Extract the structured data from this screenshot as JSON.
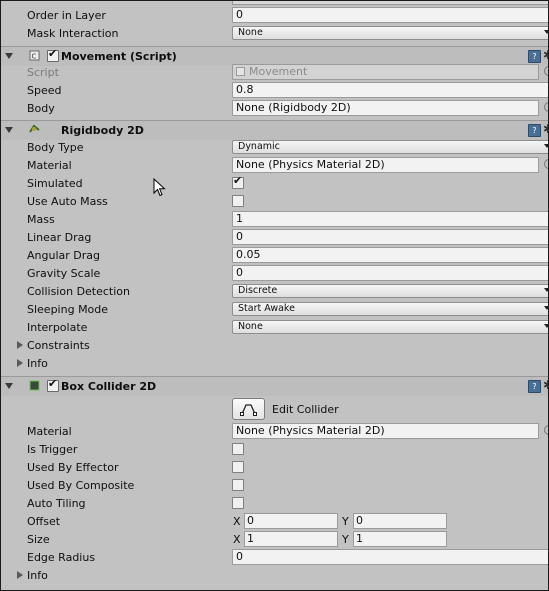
{
  "renderer": {
    "order_in_layer": {
      "label": "Order in Layer",
      "value": "0"
    },
    "mask_interaction": {
      "label": "Mask Interaction",
      "value": "None"
    }
  },
  "movement": {
    "title": "Movement (Script)",
    "help": "?",
    "gear": "✱",
    "script": {
      "label": "Script",
      "value": "Movement"
    },
    "speed": {
      "label": "Speed",
      "value": "0.8"
    },
    "body": {
      "label": "Body",
      "value": "None (Rigidbody 2D)"
    }
  },
  "rigidbody": {
    "title": "Rigidbody 2D",
    "help": "?",
    "gear": "✱",
    "body_type": {
      "label": "Body Type",
      "value": "Dynamic"
    },
    "material": {
      "label": "Material",
      "value": "None (Physics Material 2D)"
    },
    "simulated": {
      "label": "Simulated",
      "checked": true
    },
    "use_auto_mass": {
      "label": "Use Auto Mass",
      "checked": false
    },
    "mass": {
      "label": "Mass",
      "value": "1"
    },
    "linear_drag": {
      "label": "Linear Drag",
      "value": "0"
    },
    "angular_drag": {
      "label": "Angular Drag",
      "value": "0.05"
    },
    "gravity_scale": {
      "label": "Gravity Scale",
      "value": "0"
    },
    "collision_detection": {
      "label": "Collision Detection",
      "value": "Discrete"
    },
    "sleeping_mode": {
      "label": "Sleeping Mode",
      "value": "Start Awake"
    },
    "interpolate": {
      "label": "Interpolate",
      "value": "None"
    },
    "constraints": {
      "label": "Constraints"
    },
    "info": {
      "label": "Info"
    }
  },
  "box_collider": {
    "title": "Box Collider 2D",
    "help": "?",
    "gear": "✱",
    "edit_collider": "Edit Collider",
    "material": {
      "label": "Material",
      "value": "None (Physics Material 2D)"
    },
    "is_trigger": {
      "label": "Is Trigger",
      "checked": false
    },
    "used_by_effector": {
      "label": "Used By Effector",
      "checked": false
    },
    "used_by_composite": {
      "label": "Used By Composite",
      "checked": false
    },
    "auto_tiling": {
      "label": "Auto Tiling",
      "checked": false
    },
    "offset": {
      "label": "Offset",
      "x_label": "X",
      "x": "0",
      "y_label": "Y",
      "y": "0"
    },
    "size": {
      "label": "Size",
      "x_label": "X",
      "x": "1",
      "y_label": "Y",
      "y": "1"
    },
    "edge_radius": {
      "label": "Edge Radius",
      "value": "0"
    },
    "info": {
      "label": "Info"
    }
  },
  "check_glyph": "✔"
}
